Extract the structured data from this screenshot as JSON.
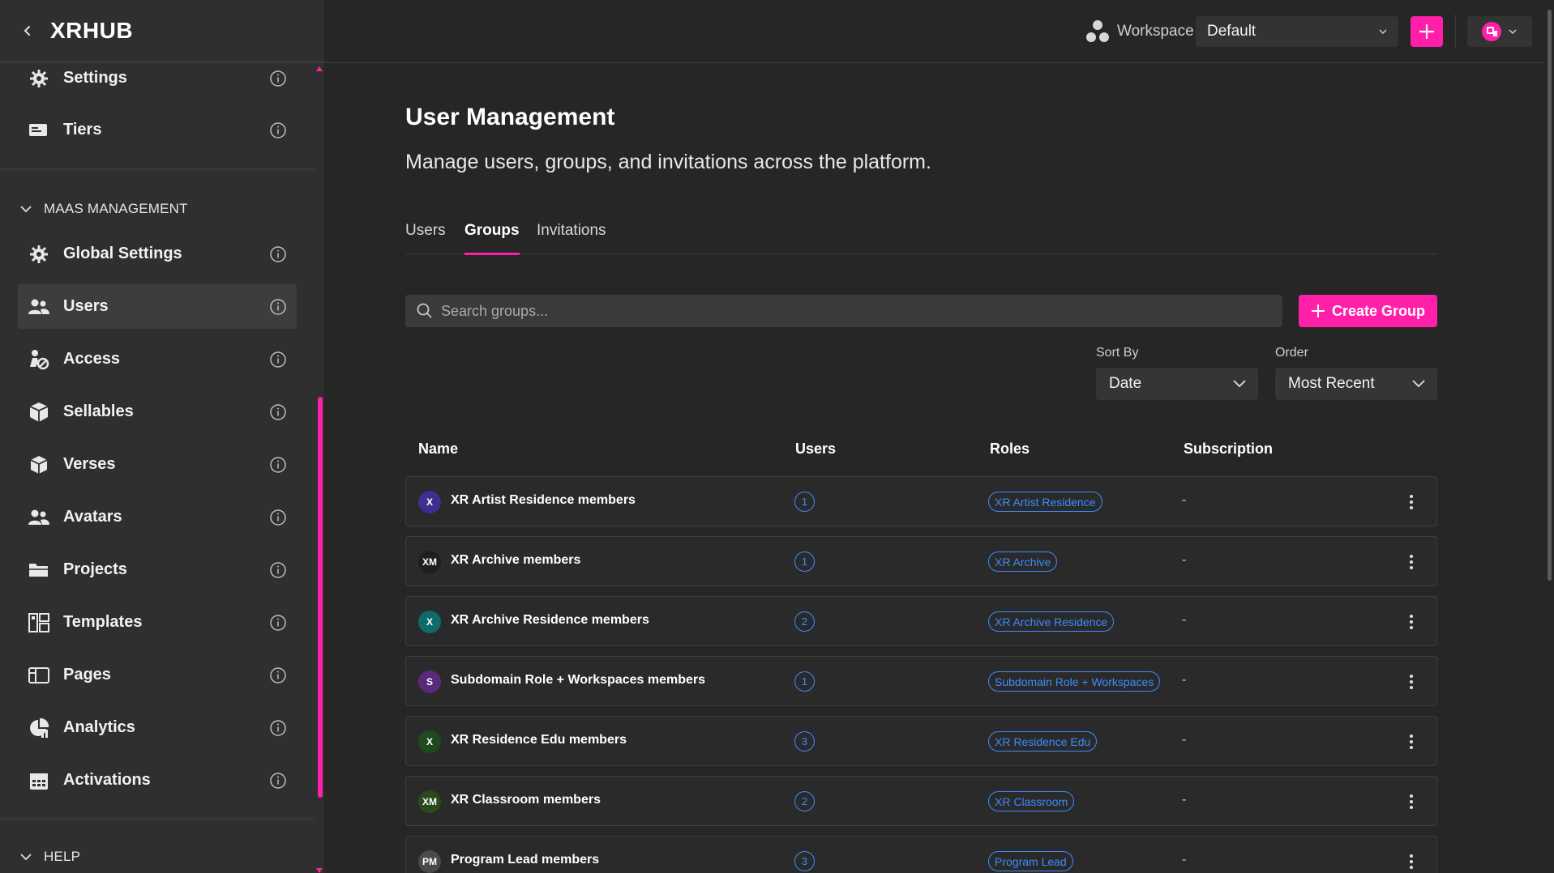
{
  "sidebar": {
    "brand": "XRHUB",
    "items_top": [
      {
        "label": "Settings",
        "icon": "gear-icon"
      },
      {
        "label": "Tiers",
        "icon": "tiers-icon"
      }
    ],
    "section_maas": "MAAS MANAGEMENT",
    "items_maas": [
      {
        "label": "Global Settings",
        "icon": "gear-icon"
      },
      {
        "label": "Users",
        "icon": "users-icon"
      },
      {
        "label": "Access",
        "icon": "access-icon"
      },
      {
        "label": "Sellables",
        "icon": "boxes-icon"
      },
      {
        "label": "Verses",
        "icon": "cube-icon"
      },
      {
        "label": "Avatars",
        "icon": "users-icon"
      },
      {
        "label": "Projects",
        "icon": "folder-icon"
      },
      {
        "label": "Templates",
        "icon": "templates-icon"
      },
      {
        "label": "Pages",
        "icon": "pages-icon"
      },
      {
        "label": "Analytics",
        "icon": "analytics-icon"
      },
      {
        "label": "Activations",
        "icon": "calendar-icon"
      }
    ],
    "section_help": "HELP",
    "active_item": "Users"
  },
  "topbar": {
    "workspace_label": "Workspace",
    "workspace_value": "Default"
  },
  "main": {
    "title": "User Management",
    "subtitle": "Manage users, groups, and invitations across the platform.",
    "tabs": [
      {
        "label": "Users"
      },
      {
        "label": "Groups"
      },
      {
        "label": "Invitations"
      }
    ],
    "active_tab": "Groups",
    "search_placeholder": "Search groups...",
    "create_label": "Create Group",
    "sort_by_label": "Sort By",
    "sort_by_value": "Date",
    "order_label": "Order",
    "order_value": "Most Recent"
  },
  "table": {
    "columns": [
      "Name",
      "Users",
      "Roles",
      "Subscription"
    ],
    "rows": [
      {
        "initials": "X",
        "avatar_color": "#3d2f8f",
        "name": "XR Artist Residence members",
        "users": "1",
        "role": "XR Artist Residence",
        "subscription": "-"
      },
      {
        "initials": "XM",
        "avatar_color": "#1e1e1e",
        "name": "XR Archive members",
        "users": "1",
        "role": "XR Archive",
        "subscription": "-"
      },
      {
        "initials": "X",
        "avatar_color": "#0f6a6a",
        "name": "XR Archive Residence members",
        "users": "2",
        "role": "XR Archive Residence",
        "subscription": "-"
      },
      {
        "initials": "S",
        "avatar_color": "#5a2a7a",
        "name": "Subdomain Role + Workspaces members",
        "users": "1",
        "role": "Subdomain Role + Workspaces",
        "subscription": "-"
      },
      {
        "initials": "X",
        "avatar_color": "#1f4a1f",
        "name": "XR Residence Edu members",
        "users": "3",
        "role": "XR Residence Edu",
        "subscription": "-"
      },
      {
        "initials": "XM",
        "avatar_color": "#2a4a1a",
        "name": "XR Classroom members",
        "users": "2",
        "role": "XR Classroom",
        "subscription": "-"
      },
      {
        "initials": "PM",
        "avatar_color": "#4a4a4a",
        "name": "Program Lead members",
        "users": "3",
        "role": "Program Lead",
        "subscription": "-"
      }
    ]
  },
  "colors": {
    "accent": "#ff1fa8",
    "link_blue": "#3b8cff"
  }
}
